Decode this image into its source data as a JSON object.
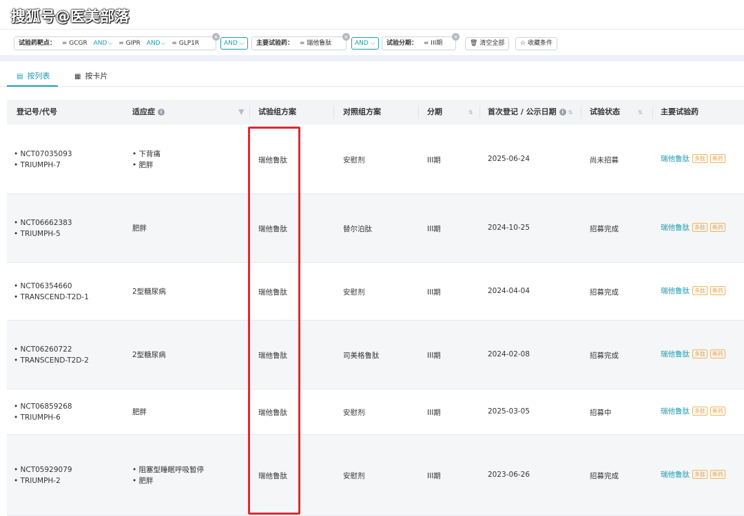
{
  "watermark": "搜狐号@医美部落",
  "filters": {
    "target_label": "试验药靶点：",
    "target_values": [
      "= GCGR",
      "= GIPR",
      "= GLP1R"
    ],
    "and_label": "AND",
    "drug_label": "主要试验药：",
    "drug_value": "= 瑞他鲁肽",
    "phase_label": "试验分期：",
    "phase_value": "= III期",
    "clear_all": "清空全部",
    "save_filter": "收藏条件"
  },
  "tabs": [
    "按列表",
    "按卡片"
  ],
  "columns": [
    "登记号/代号",
    "适应症",
    "试验组方案",
    "对照组方案",
    "分期",
    "首次登记 / 公示日期",
    "试验状态",
    "主要试验药"
  ],
  "rows": [
    {
      "ids": [
        "• NCT07035093",
        "• TRIUMPH-7"
      ],
      "indications": [
        "• 下背痛",
        "• 肥胖"
      ],
      "arm": "瑞他鲁肽",
      "control": "安慰剂",
      "phase": "III期",
      "date": "2025-06-24",
      "status": "尚未招募",
      "drug": "瑞他鲁肽",
      "tags": [
        "多肽",
        "新药"
      ]
    },
    {
      "ids": [
        "• NCT06662383",
        "• TRIUMPH-5"
      ],
      "indications": [
        "肥胖"
      ],
      "arm": "瑞他鲁肽",
      "control": "替尔泊肽",
      "phase": "III期",
      "date": "2024-10-25",
      "status": "招募完成",
      "drug": "瑞他鲁肽",
      "tags": [
        "多肽",
        "新药"
      ]
    },
    {
      "ids": [
        "• NCT06354660",
        "• TRANSCEND-T2D-1"
      ],
      "indications": [
        "2型糖尿病"
      ],
      "arm": "瑞他鲁肽",
      "control": "安慰剂",
      "phase": "III期",
      "date": "2024-04-04",
      "status": "招募完成",
      "drug": "瑞他鲁肽",
      "tags": [
        "多肽",
        "新药"
      ]
    },
    {
      "ids": [
        "• NCT06260722",
        "• TRANSCEND-T2D-2"
      ],
      "indications": [
        "2型糖尿病"
      ],
      "arm": "瑞他鲁肽",
      "control": "司美格鲁肽",
      "phase": "III期",
      "date": "2024-02-08",
      "status": "招募完成",
      "drug": "瑞他鲁肽",
      "tags": [
        "多肽",
        "新药"
      ]
    },
    {
      "ids": [
        "• NCT06859268",
        "• TRIUMPH-6"
      ],
      "indications": [
        "肥胖"
      ],
      "arm": "瑞他鲁肽",
      "control": "安慰剂",
      "phase": "III期",
      "date": "2025-03-05",
      "status": "招募中",
      "drug": "瑞他鲁肽",
      "tags": [
        "多肽",
        "新药"
      ]
    },
    {
      "ids": [
        "• NCT05929079",
        "• TRIUMPH-2"
      ],
      "indications": [
        "• 阻塞型睡眠呼吸暂停",
        "• 肥胖"
      ],
      "arm": "瑞他鲁肽",
      "control": "安慰剂",
      "phase": "III期",
      "date": "2023-06-26",
      "status": "招募完成",
      "drug": "瑞他鲁肽",
      "tags": [
        "多肽",
        "新药"
      ]
    }
  ],
  "colors": {
    "accent": "#1a9cb0",
    "highlight_box": "#e0282f",
    "tag": "#e8a040"
  }
}
